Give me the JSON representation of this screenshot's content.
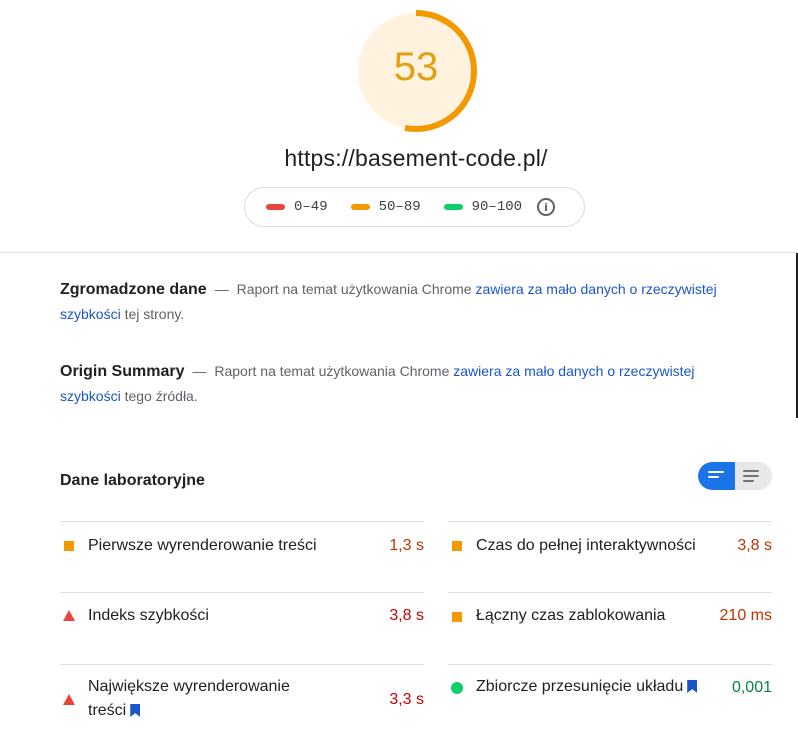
{
  "score": {
    "value": "53",
    "fraction": 0.53,
    "color": "#f29900",
    "bg_color": "#fff3e0"
  },
  "url": "https://basement-code.pl/",
  "legend": {
    "ranges": [
      {
        "label": "0–49",
        "color": "#e8453c"
      },
      {
        "label": "50–89",
        "color": "#f29900"
      },
      {
        "label": "90–100",
        "color": "#0cce6b"
      }
    ],
    "info_icon": "info-icon"
  },
  "field_data": {
    "title": "Zgromadzone dane",
    "sep": "—",
    "text_before": "Raport na temat użytkowania Chrome",
    "link": "zawiera za mało danych o rzeczywistej szybkości",
    "text_after": "tej strony."
  },
  "origin_summary": {
    "title": "Origin Summary",
    "sep": "—",
    "text_before": "Raport na temat użytkowania Chrome",
    "link": "zawiera za mało danych o rzeczywistej szybkości",
    "text_after": "tego źródła."
  },
  "lab": {
    "title": "Dane laboratoryjne",
    "view_toggle": [
      "compact-view",
      "expanded-view"
    ],
    "metrics_left": [
      {
        "name": "Pierwsze wyrenderowanie treści",
        "value": "1,3 s",
        "status": "average",
        "icon": "square",
        "value_color": "#c33300"
      },
      {
        "name": "Indeks szybkości",
        "value": "3,8 s",
        "status": "fail",
        "icon": "triangle",
        "value_color": "#cc0000"
      },
      {
        "name": "Największe wyrenderowanie",
        "name_line2": "treści",
        "value": "3,3 s",
        "status": "fail",
        "icon": "triangle",
        "value_color": "#cc0000",
        "bookmark": true
      }
    ],
    "metrics_right": [
      {
        "name": "Czas do pełnej interaktywności",
        "value": "3,8 s",
        "status": "average",
        "icon": "square",
        "value_color": "#c33300"
      },
      {
        "name": "Łączny czas zablokowania",
        "value": "210 ms",
        "status": "average",
        "icon": "square",
        "value_color": "#c33300"
      },
      {
        "name": "Zbiorcze przesunięcie układu",
        "value": "0,001",
        "status": "pass",
        "icon": "circle",
        "value_color": "#018642",
        "bookmark": true
      }
    ]
  }
}
